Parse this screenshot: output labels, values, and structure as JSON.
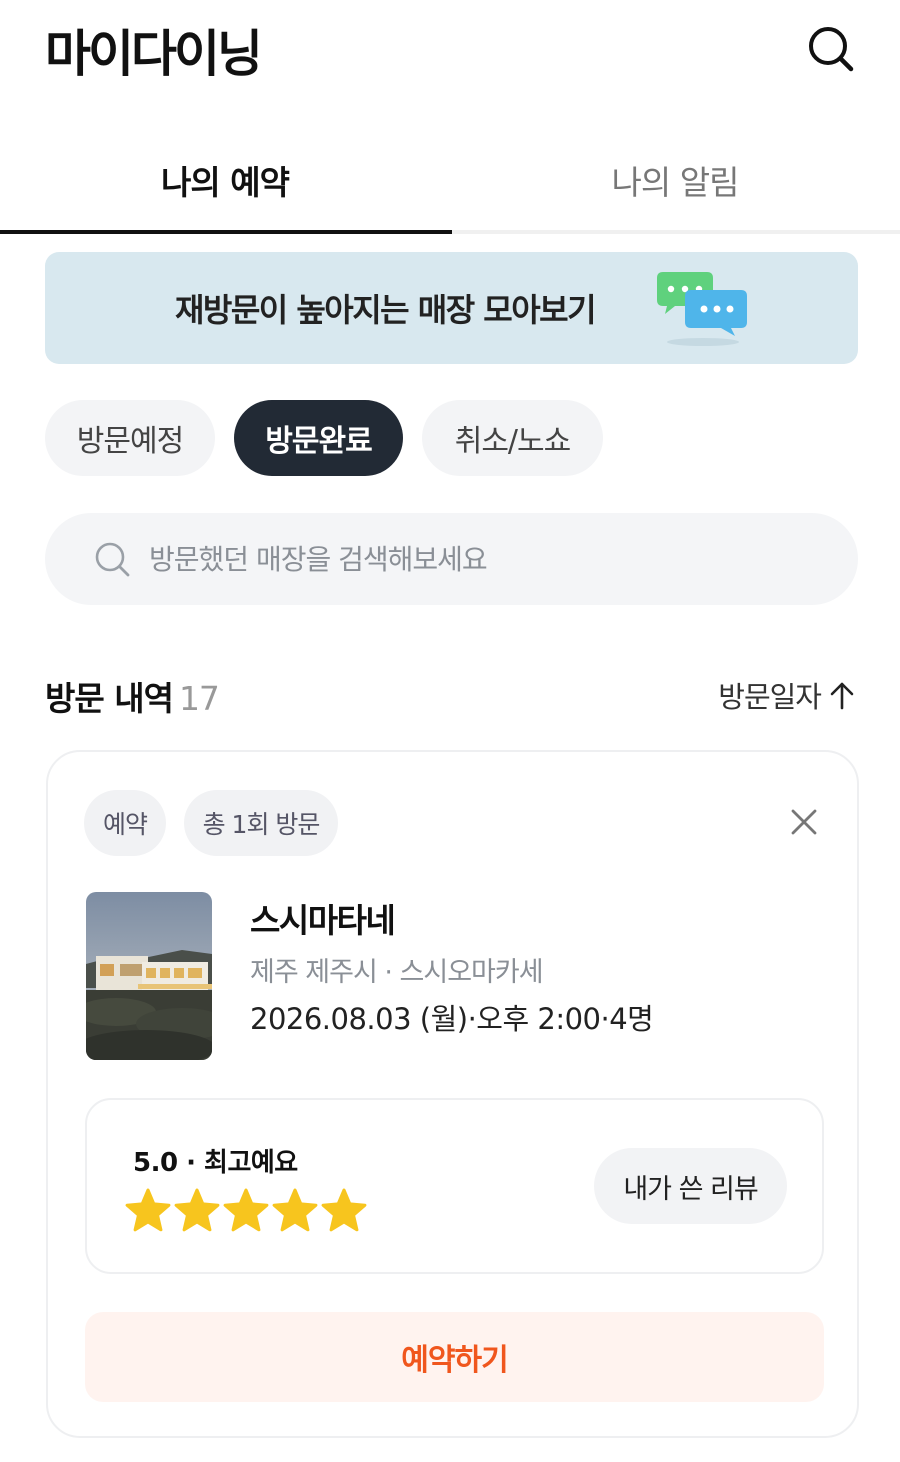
{
  "app": {
    "title": "마이다이닝"
  },
  "tabs": [
    {
      "label": "나의 예약",
      "active": true
    },
    {
      "label": "나의 알림",
      "active": false
    }
  ],
  "banner": {
    "text": "재방문이 높아지는 매장 모아보기",
    "icon": "chat-bubbles-icon"
  },
  "filters": {
    "chips": [
      {
        "label": "방문예정",
        "selected": false
      },
      {
        "label": "방문완료",
        "selected": true
      },
      {
        "label": "취소/노쇼",
        "selected": false
      }
    ]
  },
  "search": {
    "placeholder": "방문했던 매장을 검색해보세요",
    "value": ""
  },
  "history": {
    "title": "방문 내역",
    "count": "17",
    "sort_label": "방문일자",
    "sort_direction": "ascending"
  },
  "card": {
    "tags": [
      "예약",
      "총 1회 방문"
    ],
    "store": {
      "name": "스시마타네",
      "meta": "제주 제주시 · 스시오마카세",
      "datetime": "2026.08.03 (월)·오후 2:00·4명"
    },
    "review": {
      "rating_text": "5.0 · 최고예요",
      "rating": 5,
      "max_rating": 5,
      "my_review_label": "내가 쓴 리뷰"
    },
    "reserve_label": "예약하기"
  },
  "colors": {
    "accent": "#f0561d",
    "accent_bg": "#fff3ef",
    "selected_chip": "#222a35",
    "banner_bg": "#d8e8ef",
    "star": "#f7c51e"
  }
}
